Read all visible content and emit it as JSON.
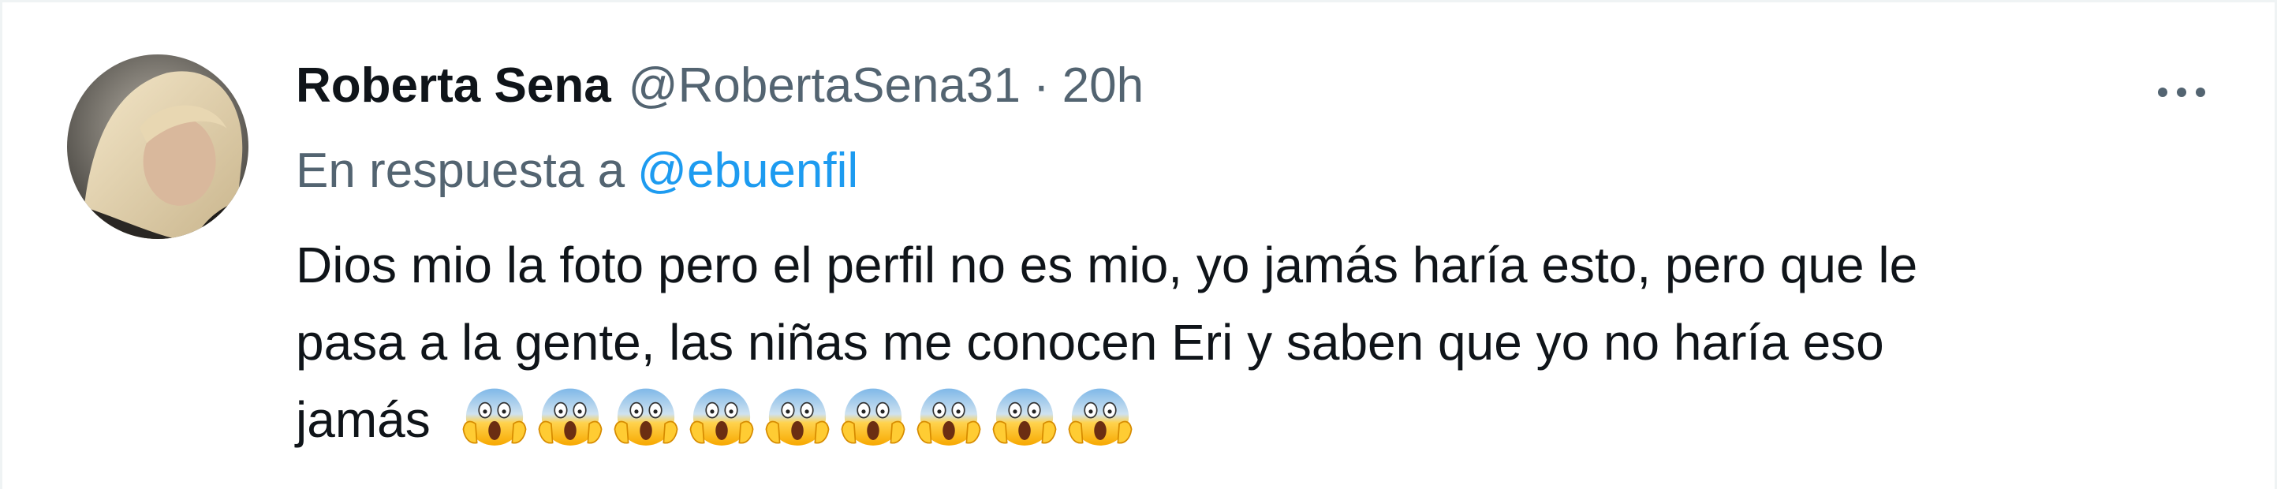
{
  "tweet": {
    "display_name": "Roberta Sena",
    "handle": "@RobertaSena31",
    "separator": "·",
    "time": "20h",
    "reply_prefix": "En respuesta a",
    "reply_to": "@ebuenfil",
    "text_line1": "Dios mio la foto pero el perfil no es mio, yo jamás haría esto, pero que le",
    "text_line2": "pasa a la gente, las niñas me conocen Eri y saben que yo no haría eso",
    "text_line3": "jamás",
    "emoji": "😱",
    "emoji_count": 9,
    "more_icon": "more-horizontal-icon"
  },
  "colors": {
    "name": "#0f1419",
    "secondary": "#536471",
    "link": "#1d9bf0"
  }
}
